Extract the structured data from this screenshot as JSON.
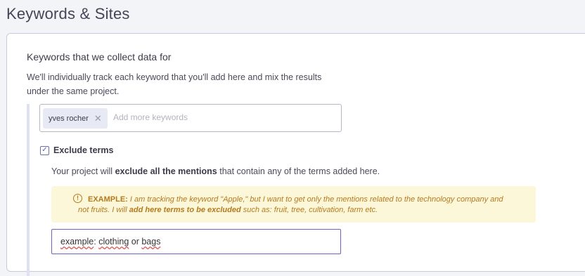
{
  "page": {
    "title": "Keywords & Sites"
  },
  "keywords_section": {
    "heading": "Keywords that we collect data for",
    "description": "We'll individually track each keyword that you'll add here and mix the results under the same project.",
    "chips": [
      {
        "label": "yves rocher",
        "remove_icon": "close-icon"
      }
    ],
    "input_placeholder": "Add more keywords"
  },
  "exclude": {
    "checked": true,
    "label": "Exclude terms",
    "desc_prefix": "Your project will ",
    "desc_bold": "exclude all the mentions",
    "desc_suffix": " that contain any of the terms added here.",
    "example": {
      "icon": "info-icon",
      "label": "EXAMPLE:",
      "text_part1": " I am tracking the keyword \"Apple,\" but I want to get only the mentions related to the technology company and not fruits. I will ",
      "text_bold": "add here terms to be excluded",
      "text_part2": " such as: fruit, tree, cultivation, farm etc."
    },
    "terms_input": {
      "value_words": [
        "example",
        ": ",
        "clothing",
        " or ",
        "bags"
      ]
    }
  },
  "colors": {
    "accent": "#6b63c9",
    "example_bg": "#fdf7d9",
    "example_text": "#b47a1e",
    "chip_bg": "#e7e9f4"
  }
}
